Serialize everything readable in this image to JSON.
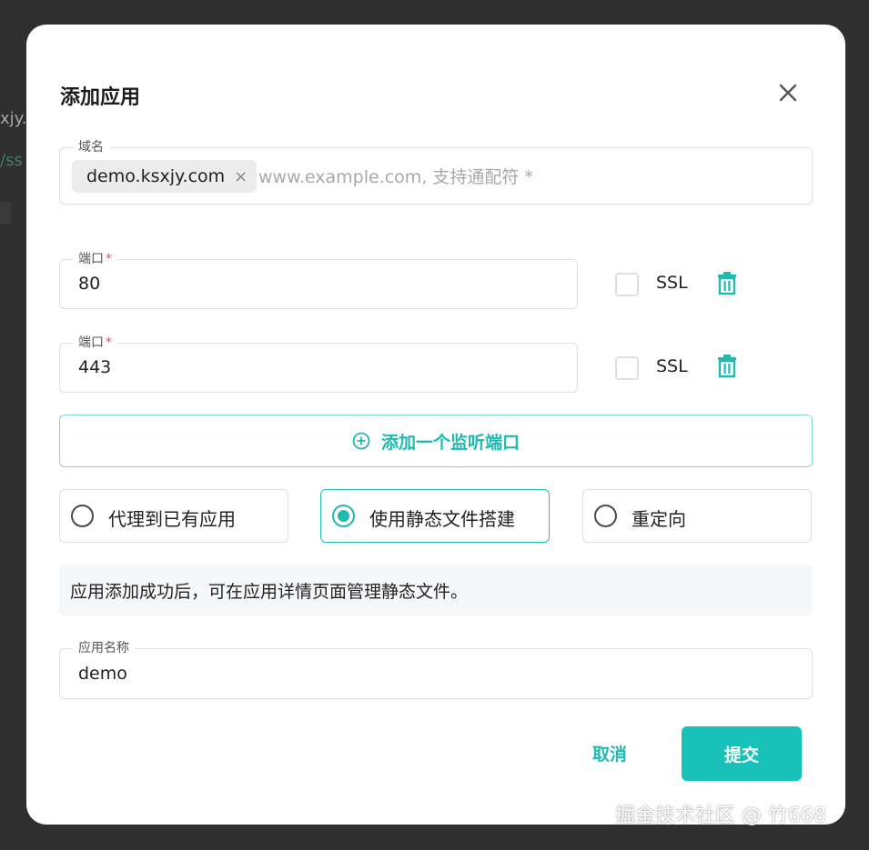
{
  "backdrop": {
    "line1": "xjy.c",
    "line2": "/ss"
  },
  "dialog": {
    "title": "添加应用",
    "close_icon": "close-icon"
  },
  "domain": {
    "legend": "域名",
    "chip": "demo.ksxjy.com",
    "chip_remove": "×",
    "placeholder": "www.example.com, 支持通配符 *"
  },
  "ports": [
    {
      "legend": "端口",
      "required_mark": "*",
      "value": "80",
      "ssl_label": "SSL",
      "ssl_checked": false
    },
    {
      "legend": "端口",
      "required_mark": "*",
      "value": "443",
      "ssl_label": "SSL",
      "ssl_checked": false
    }
  ],
  "add_port": {
    "label": "添加一个监听端口",
    "icon": "plus-circle-icon"
  },
  "options": [
    {
      "label": "代理到已有应用",
      "selected": false
    },
    {
      "label": "使用静态文件搭建",
      "selected": true
    },
    {
      "label": "重定向",
      "selected": false
    }
  ],
  "notice": "应用添加成功后，可在应用详情页面管理静态文件。",
  "app_name": {
    "legend": "应用名称",
    "value": "demo"
  },
  "actions": {
    "cancel": "取消",
    "submit": "提交"
  },
  "watermark": "掘金技术社区 @ 竹668",
  "colors": {
    "accent": "#18c2b8",
    "accent_text": "#1fb9b0",
    "required": "#e85050",
    "backdrop": "#2f2f2f"
  }
}
